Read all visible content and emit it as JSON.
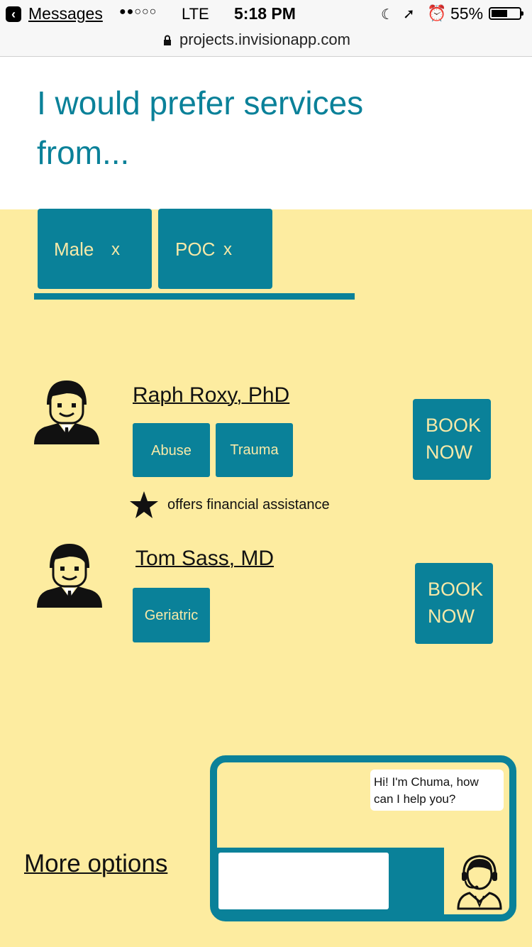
{
  "status_bar": {
    "back_label": "Messages",
    "signal": "●●○○○",
    "carrier": "LTE",
    "time": "5:18 PM",
    "battery": "55%"
  },
  "url_bar": {
    "url": "projects.invisionapp.com"
  },
  "header": {
    "title": "I would prefer services from..."
  },
  "filters": [
    {
      "label": "Male",
      "remove": "x"
    },
    {
      "label": "POC",
      "remove": "x"
    }
  ],
  "providers": [
    {
      "name": "Raph Roxy, PhD",
      "tags": [
        "Abuse",
        "Trauma"
      ],
      "note": "offers financial assistance",
      "book_line1": "BOOK",
      "book_line2": "NOW"
    },
    {
      "name": "Tom Sass, MD",
      "tags": [
        "Geriatric"
      ],
      "book_line1": "BOOK",
      "book_line2": "NOW"
    }
  ],
  "more_options": "More options",
  "chat": {
    "greeting": "Hi! I'm Chuma, how can I help you?",
    "input_value": ""
  },
  "colors": {
    "accent": "#0a8199",
    "background": "#fdeca0",
    "chip_text": "#f7e9a8"
  },
  "icons": {
    "back": "chevron-left-icon",
    "lock": "lock-icon",
    "star": "star-icon",
    "agent": "headset-agent-icon",
    "avatar": "person-avatar-icon"
  }
}
